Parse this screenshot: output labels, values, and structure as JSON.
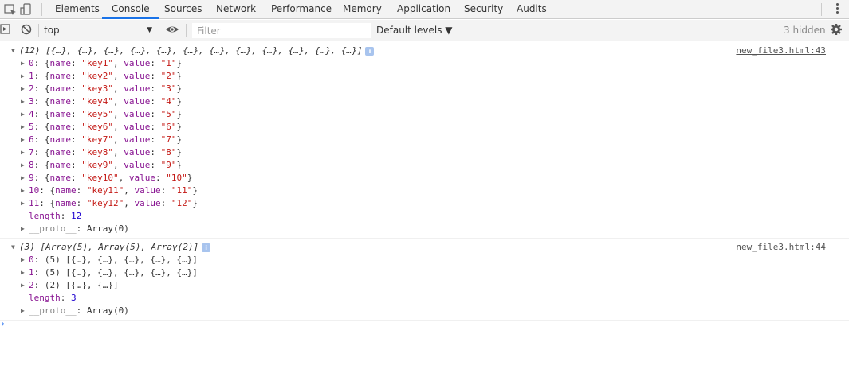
{
  "tabs": [
    {
      "label": "Elements",
      "active": false
    },
    {
      "label": "Console",
      "active": true
    },
    {
      "label": "Sources",
      "active": false
    },
    {
      "label": "Network",
      "active": false
    },
    {
      "label": "Performance",
      "active": false
    },
    {
      "label": "Memory",
      "active": false
    },
    {
      "label": "Application",
      "active": false
    },
    {
      "label": "Security",
      "active": false
    },
    {
      "label": "Audits",
      "active": false
    }
  ],
  "toolbar": {
    "context": "top",
    "filter_placeholder": "Filter",
    "levels": "Default levels ▼",
    "hidden": "3 hidden"
  },
  "messages": [
    {
      "source": "new_file3.html:43",
      "summary": "(12) [{…}, {…}, {…}, {…}, {…}, {…}, {…}, {…}, {…}, {…}, {…}, {…}]",
      "items": [
        {
          "index": "0",
          "name": "\"key1\"",
          "value": "\"1\""
        },
        {
          "index": "1",
          "name": "\"key2\"",
          "value": "\"2\""
        },
        {
          "index": "2",
          "name": "\"key3\"",
          "value": "\"3\""
        },
        {
          "index": "3",
          "name": "\"key4\"",
          "value": "\"4\""
        },
        {
          "index": "4",
          "name": "\"key5\"",
          "value": "\"5\""
        },
        {
          "index": "5",
          "name": "\"key6\"",
          "value": "\"6\""
        },
        {
          "index": "6",
          "name": "\"key7\"",
          "value": "\"7\""
        },
        {
          "index": "7",
          "name": "\"key8\"",
          "value": "\"8\""
        },
        {
          "index": "8",
          "name": "\"key9\"",
          "value": "\"9\""
        },
        {
          "index": "9",
          "name": "\"key10\"",
          "value": "\"10\""
        },
        {
          "index": "10",
          "name": "\"key11\"",
          "value": "\"11\""
        },
        {
          "index": "11",
          "name": "\"key12\"",
          "value": "\"12\""
        }
      ],
      "length_label": "length",
      "length_value": "12",
      "proto_label": "__proto__",
      "proto_value": "Array(0)"
    },
    {
      "source": "new_file3.html:44",
      "summary": "(3) [Array(5), Array(5), Array(2)]",
      "items": [
        {
          "index": "0",
          "text": "(5) [{…}, {…}, {…}, {…}, {…}]"
        },
        {
          "index": "1",
          "text": "(5) [{…}, {…}, {…}, {…}, {…}]"
        },
        {
          "index": "2",
          "text": "(2) [{…}, {…}]"
        }
      ],
      "length_label": "length",
      "length_value": "3",
      "proto_label": "__proto__",
      "proto_value": "Array(0)"
    }
  ],
  "prompt": "›"
}
